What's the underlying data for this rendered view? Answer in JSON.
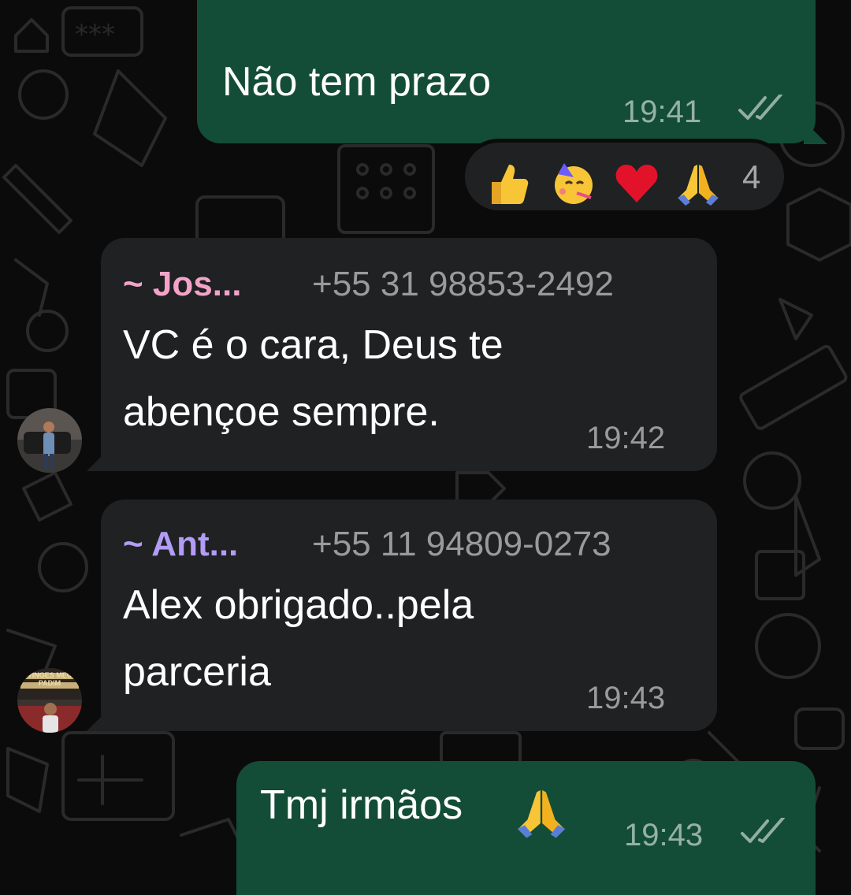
{
  "messages": [
    {
      "direction": "outgoing",
      "text": "Não tem prazo",
      "time": "19:41",
      "status": "read-double-check"
    },
    {
      "direction": "incoming",
      "sender_name": "~ Jos...",
      "sender_phone": "+55 31 98853-2492",
      "lines": [
        "VC é o cara, Deus te",
        "abençoe sempre."
      ],
      "time": "19:42",
      "name_color": "#f3a3c9"
    },
    {
      "direction": "incoming",
      "sender_name": "~ Ant...",
      "sender_phone": "+55 11 94809-0273",
      "lines": [
        "Alex obrigado..pela",
        "parceria"
      ],
      "time": "19:43",
      "name_color": "#b39cf6"
    },
    {
      "direction": "outgoing",
      "text": "Tmj irmãos",
      "time": "19:43",
      "status": "read-double-check",
      "trailing_icon": "folded-hands-emoji"
    }
  ],
  "reactions": {
    "icons": [
      "thumbs-up-emoji",
      "partying-face-emoji",
      "red-heart-emoji",
      "folded-hands-emoji"
    ],
    "count": "4"
  },
  "avatar_badge_text": "VINGES MEU PADIM",
  "colors": {
    "background": "#0b0b0b",
    "outgoing_bubble": "#144d37",
    "incoming_bubble": "#1f2123",
    "timestamp": "#8f9192"
  }
}
